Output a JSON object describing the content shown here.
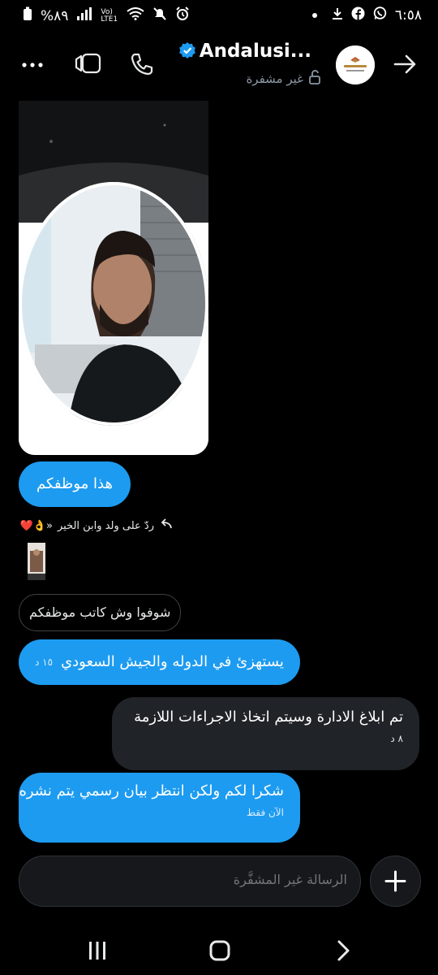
{
  "status": {
    "battery": "%٨٩",
    "time": "٦:٥٨",
    "network": "Vo) LTE1"
  },
  "header": {
    "title": "Andalusi...",
    "subtitle": "غير مشفرة"
  },
  "messages": {
    "m1": "هذا موظفكم",
    "reply_label": "ردّ على ولد وابن الخير",
    "reply_emoji": "«👌❤️",
    "quoted": "شوفوا وش كاتب موظفكم",
    "m2": "يستهزئ في الدوله والجيش السعودي",
    "m2_time": "١٥ د",
    "m3": "تم ابلاغ الادارة وسيتم اتخاذ الاجراءات اللازمة",
    "m3_time": "٨ د",
    "m4": "شكرا لكم ولكن انتظر بيان رسمي يتم نشره",
    "m4_time": "الآن فقط"
  },
  "composer": {
    "placeholder": "الرسالة غير المشفَّرة"
  },
  "colors": {
    "accent": "#1d9bf0",
    "incoming": "#202327",
    "background": "#000000"
  }
}
